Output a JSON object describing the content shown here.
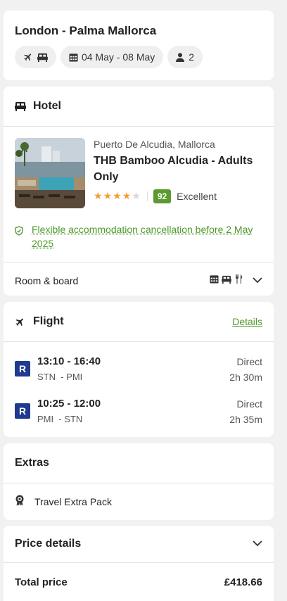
{
  "trip": {
    "route": "London - Palma Mallorca",
    "dates": "04 May - 08 May",
    "travellers": "2"
  },
  "hotel": {
    "section_title": "Hotel",
    "location": "Puerto De Alcudia, Mallorca",
    "name": "THB Bamboo Alcudia - Adults Only",
    "stars": 4,
    "max_stars": 5,
    "score": "92",
    "score_label": "Excellent",
    "cancellation": "Flexible accommodation cancellation before 2 May 2025",
    "room_board_label": "Room & board"
  },
  "flight": {
    "section_title": "Flight",
    "details_link": "Details",
    "legs": [
      {
        "airline_code": "R",
        "times": "13:10 - 16:40",
        "route": "STN  - PMI",
        "type": "Direct",
        "duration": "2h 30m"
      },
      {
        "airline_code": "R",
        "times": "10:25 - 12:00",
        "route": "PMI  - STN",
        "type": "Direct",
        "duration": "2h 35m"
      }
    ]
  },
  "extras": {
    "section_title": "Extras",
    "items": [
      "Travel Extra Pack"
    ]
  },
  "price": {
    "section_title": "Price details",
    "total_label": "Total price",
    "total_value": "£418.66"
  },
  "colors": {
    "accent_green": "#4f9a2c",
    "score_badge": "#5b9a2f",
    "airline_blue": "#1f3a8f",
    "star": "#f0a030"
  }
}
